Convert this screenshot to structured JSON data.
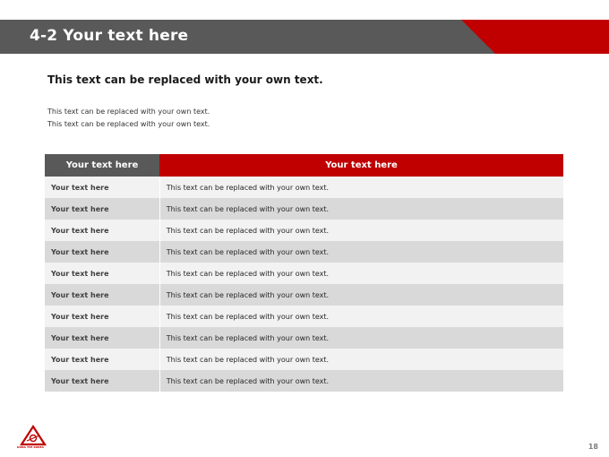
{
  "header": {
    "title": "4-2 Your text here",
    "bar_color": "#595959",
    "accent_color": "#c00000"
  },
  "content": {
    "subtitle": "This text can be replaced with your own text.",
    "lines": [
      "This text can be replaced with your own text.",
      "This text can be replaced with your own text."
    ]
  },
  "table": {
    "headers": [
      "Your text here",
      "Your text here"
    ],
    "rows": [
      [
        "Your text here",
        "This text can be replaced with your own text."
      ],
      [
        "Your text here",
        "This text can be replaced with your own text."
      ],
      [
        "Your text here",
        "This text can be replaced with your own text."
      ],
      [
        "Your text here",
        "This text can be replaced with your own text."
      ],
      [
        "Your text here",
        "This text can be replaced with your own text."
      ],
      [
        "Your text here",
        "This text can be replaced with your own text."
      ],
      [
        "Your text here",
        "This text can be replaced with your own text."
      ],
      [
        "Your text here",
        "This text can be replaced with your own text."
      ],
      [
        "Your text here",
        "This text can be replaced with your own text."
      ],
      [
        "Your text here",
        "This text can be replaced with your own text."
      ]
    ]
  },
  "footer": {
    "logo_text": "DONG YPE KOREA",
    "page_number": "18"
  }
}
